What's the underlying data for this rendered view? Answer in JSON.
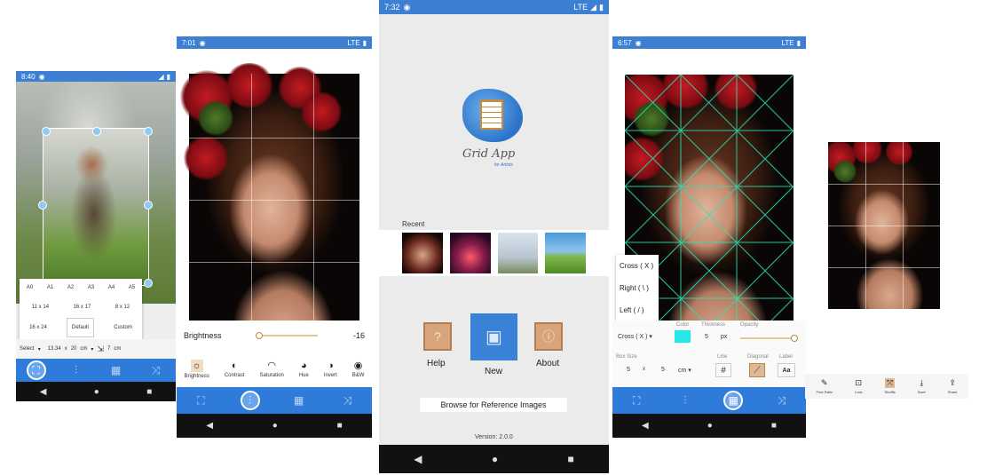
{
  "screen1": {
    "status_time": "8:40",
    "paper_sizes_row1": [
      "A0",
      "A1",
      "A2",
      "A3",
      "A4",
      "A5"
    ],
    "paper_sizes_row2": [
      "11 x 14",
      "16 x 17",
      "8 x 12"
    ],
    "paper_sizes_row3": [
      "16 x 24",
      "Default",
      "Custom"
    ],
    "size_select": "Select",
    "dim_w": "13.34",
    "times": "x",
    "dim_h": "20",
    "unit": "cm",
    "side_value": "7",
    "side_unit": "cm"
  },
  "screen2": {
    "status_time": "7:01",
    "status_lte": "LTE",
    "brightness_label": "Brightness",
    "brightness_value": "-16",
    "tools": [
      "Brightness",
      "Contrast",
      "Saturation",
      "Hue",
      "Invert",
      "B&W"
    ]
  },
  "screen3": {
    "status_time": "7:32",
    "status_lte": "LTE",
    "logo_title": "Grid App",
    "logo_sub": "for Artists",
    "recent_label": "Recent",
    "help_label": "Help",
    "new_label": "New",
    "about_label": "About",
    "browse_label": "Browse for Reference Images",
    "version": "Version: 2.0.0"
  },
  "screen4": {
    "status_time": "6:57",
    "status_lte": "LTE",
    "menu_items": [
      "Cross ( X )",
      "Right ( \\ )",
      "Left ( / )"
    ],
    "type_select": "Cross ( X )",
    "color_label": "Color",
    "thickness_label": "Thickness",
    "thickness_value": "5",
    "thickness_unit": "px",
    "opacity_label": "Opacity",
    "box_size_label": "Box Size",
    "box_w": "5",
    "times": "x",
    "box_h": "5",
    "box_unit": "cm",
    "line_label": "Line",
    "diagonal_label": "Diagonal",
    "label_label": "Label",
    "label_btn": "Aa",
    "accent_color": "#27e6e6"
  },
  "screen5": {
    "tools": [
      "Free Ratio",
      "Lock",
      "Shuffle",
      "Save",
      "Share"
    ]
  }
}
